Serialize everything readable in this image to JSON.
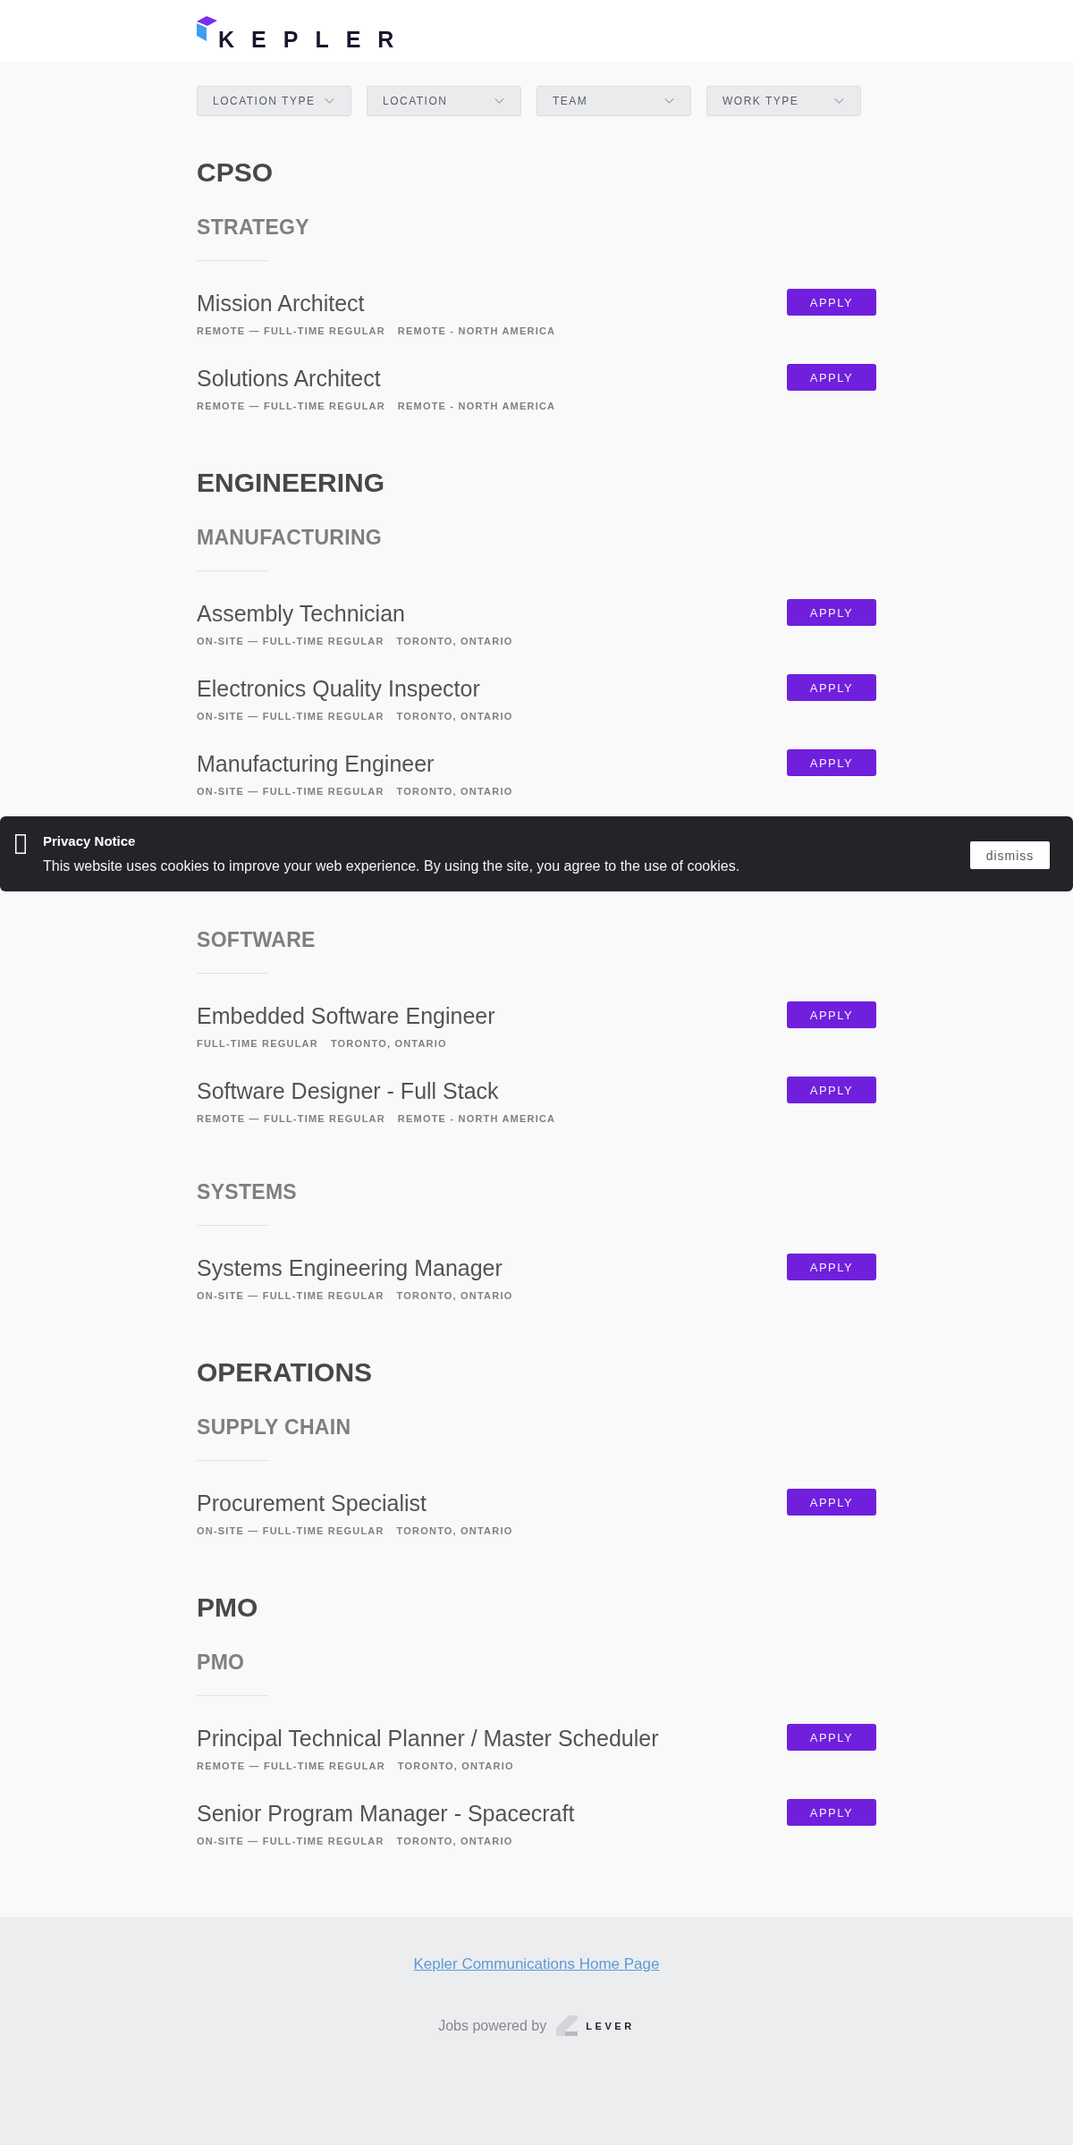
{
  "header": {
    "logo_text": "KEPLER"
  },
  "filters": [
    "LOCATION TYPE",
    "LOCATION",
    "TEAM",
    "WORK TYPE"
  ],
  "departments": [
    {
      "title": "CPSO",
      "teams": [
        {
          "title": "STRATEGY",
          "postings": [
            {
              "title": "Mission Architect",
              "commitment": "REMOTE — FULL-TIME REGULAR",
              "location": "REMOTE - NORTH AMERICA",
              "action": "APPLY"
            },
            {
              "title": "Solutions Architect",
              "commitment": "REMOTE — FULL-TIME REGULAR",
              "location": "REMOTE - NORTH AMERICA",
              "action": "APPLY"
            }
          ]
        }
      ]
    },
    {
      "title": "ENGINEERING",
      "teams": [
        {
          "title": "MANUFACTURING",
          "postings": [
            {
              "title": "Assembly Technician",
              "commitment": "ON-SITE — FULL-TIME REGULAR",
              "location": "TORONTO, ONTARIO",
              "action": "APPLY"
            },
            {
              "title": "Electronics Quality Inspector",
              "commitment": "ON-SITE — FULL-TIME REGULAR",
              "location": "TORONTO, ONTARIO",
              "action": "APPLY"
            },
            {
              "title": "Manufacturing Engineer",
              "commitment": "ON-SITE — FULL-TIME REGULAR",
              "location": "TORONTO, ONTARIO",
              "action": "APPLY"
            }
          ]
        },
        {
          "title": "SOFTWARE",
          "postings": [
            {
              "title": "Embedded Software Engineer",
              "commitment": "FULL-TIME REGULAR",
              "location": "TORONTO, ONTARIO",
              "action": "APPLY"
            },
            {
              "title": "Software Designer - Full Stack",
              "commitment": "REMOTE — FULL-TIME REGULAR",
              "location": "REMOTE - NORTH AMERICA",
              "action": "APPLY"
            }
          ]
        },
        {
          "title": "SYSTEMS",
          "postings": [
            {
              "title": "Systems Engineering Manager",
              "commitment": "ON-SITE — FULL-TIME REGULAR",
              "location": "TORONTO, ONTARIO",
              "action": "APPLY"
            }
          ]
        }
      ]
    },
    {
      "title": "OPERATIONS",
      "teams": [
        {
          "title": "SUPPLY CHAIN",
          "postings": [
            {
              "title": "Procurement Specialist",
              "commitment": "ON-SITE — FULL-TIME REGULAR",
              "location": "TORONTO, ONTARIO",
              "action": "APPLY"
            }
          ]
        }
      ]
    },
    {
      "title": "PMO",
      "teams": [
        {
          "title": "PMO",
          "postings": [
            {
              "title": "Principal Technical Planner / Master Scheduler",
              "commitment": "REMOTE — FULL-TIME REGULAR",
              "location": "TORONTO, ONTARIO",
              "action": "APPLY"
            },
            {
              "title": "Senior Program Manager - Spacecraft",
              "commitment": "ON-SITE — FULL-TIME REGULAR",
              "location": "TORONTO, ONTARIO",
              "action": "APPLY"
            }
          ]
        }
      ]
    }
  ],
  "privacy_notice": {
    "title": "Privacy Notice",
    "text": "This website uses cookies to improve your web experience. By using the site, you agree to the use of cookies.",
    "button": "dismiss"
  },
  "footer": {
    "link": "Kepler Communications Home Page",
    "powered_by": "Jobs powered by",
    "brand": "LEVER"
  }
}
